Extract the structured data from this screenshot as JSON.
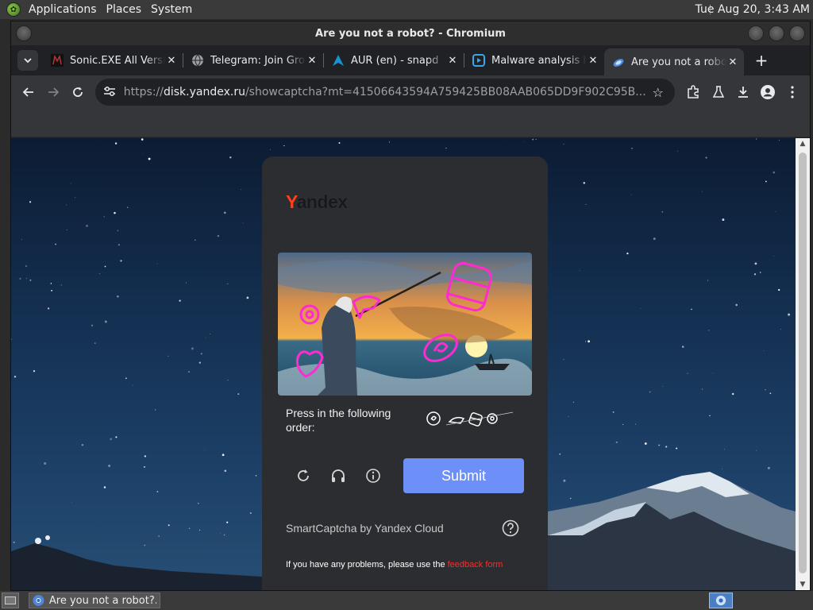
{
  "top_panel": {
    "menus": [
      "Applications",
      "Places",
      "System"
    ],
    "clock": "Tue Aug 20,  3:43 AM"
  },
  "window": {
    "title": "Are you not a robot? - Chromium"
  },
  "tabs": [
    {
      "label": "Sonic.EXE All Versions",
      "icon": "sonic-favicon"
    },
    {
      "label": "Telegram: Join Group Chat",
      "icon": "globe-icon"
    },
    {
      "label": "AUR (en) - snapd",
      "icon": "arch-icon"
    },
    {
      "label": "Malware analysis https",
      "icon": "any-run-icon"
    },
    {
      "label": "Are you not a robot?",
      "icon": "yandex-disk-icon",
      "active": true
    }
  ],
  "toolbar": {
    "url_scheme": "https://",
    "url_host": "disk.yandex.ru",
    "url_path": "/showcaptcha?mt=41506643594A759425BB08AAB065DD9F902C95B..."
  },
  "captcha": {
    "logo_first": "Y",
    "logo_rest": "andex",
    "order_label": "Press in the following order:",
    "submit_label": "Submit",
    "credit": "SmartCaptcha by Yandex Cloud",
    "problem_prefix": "If you have any problems, please use the ",
    "feedback_link": "feedback form"
  },
  "taskbar": {
    "task_label": "Are you not a robot?..."
  },
  "colors": {
    "accent_submit": "#6c8ff8",
    "yandex_red": "#fc3f1d",
    "link_red": "#ff2a2a"
  }
}
